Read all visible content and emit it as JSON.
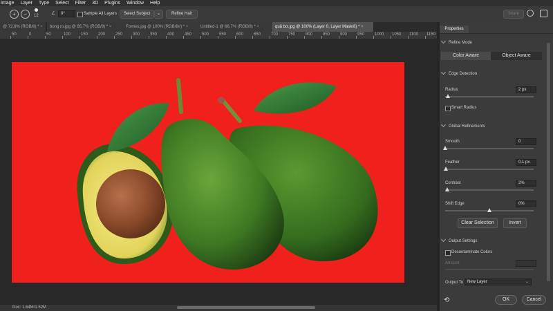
{
  "menu": [
    "Image",
    "Layer",
    "Type",
    "Select",
    "Filter",
    "3D",
    "Plugins",
    "Window",
    "Help"
  ],
  "options_bar": {
    "brush_size": "12",
    "angle": "0°",
    "sample_all_layers": "Sample All Layers",
    "select_subject": "Select Subject",
    "refine_hair": "Refine Hair",
    "share": "Share"
  },
  "tabs": [
    {
      "label": "@ 72.8% (RGB/8) *",
      "active": false
    },
    {
      "label": "bong ro.jpg @ 85.7% (RGB/8) *",
      "active": false
    },
    {
      "label": "Folmes.jpg @ 100% (RGB/8#) *",
      "active": false
    },
    {
      "label": "Untitled-1 @ 66.7% (RGB/8) *",
      "active": false
    },
    {
      "label": "quả bơ.jpg @ 100% (Layer 0, Layer Mask/8) *",
      "active": true
    }
  ],
  "ruler": [
    "50",
    "0",
    "50",
    "100",
    "150",
    "200",
    "250",
    "300",
    "350",
    "400",
    "450",
    "500",
    "550",
    "600",
    "650",
    "700",
    "750",
    "800",
    "850",
    "900",
    "950",
    "1000",
    "1050",
    "1100",
    "1150"
  ],
  "status": {
    "doc": "Doc: 1.64M/1.52M"
  },
  "panel": {
    "tab": "Properties",
    "refine_mode": {
      "title": "Refine Mode",
      "options": [
        "Color Aware",
        "Object Aware"
      ],
      "selected": "Color Aware"
    },
    "edge_detection": {
      "title": "Edge Detection",
      "radius_label": "Radius",
      "radius_value": "2 px",
      "radius_level": 0.03,
      "smart_radius": "Smart Radius"
    },
    "global_refinements": {
      "title": "Global Refinements",
      "smooth_label": "Smooth",
      "smooth_value": "0",
      "smooth_level": 0,
      "feather_label": "Feather",
      "feather_value": "0.1 px",
      "feather_level": 0.01,
      "contrast_label": "Contrast",
      "contrast_value": "2%",
      "contrast_level": 0.02,
      "shift_label": "Shift Edge",
      "shift_value": "0%",
      "shift_level": 0.5,
      "clear_selection": "Clear Selection",
      "invert": "Invert"
    },
    "output_settings": {
      "title": "Output Settings",
      "decontaminate": "Decontaminate Colors",
      "amount_label": "Amount",
      "output_to_label": "Output To",
      "output_to_value": "New Layer"
    },
    "ok": "OK",
    "cancel": "Cancel"
  },
  "colors": {
    "canvas_bg": "#f0201c",
    "panel_bg": "#3b3b3b",
    "workspace": "#282828"
  }
}
